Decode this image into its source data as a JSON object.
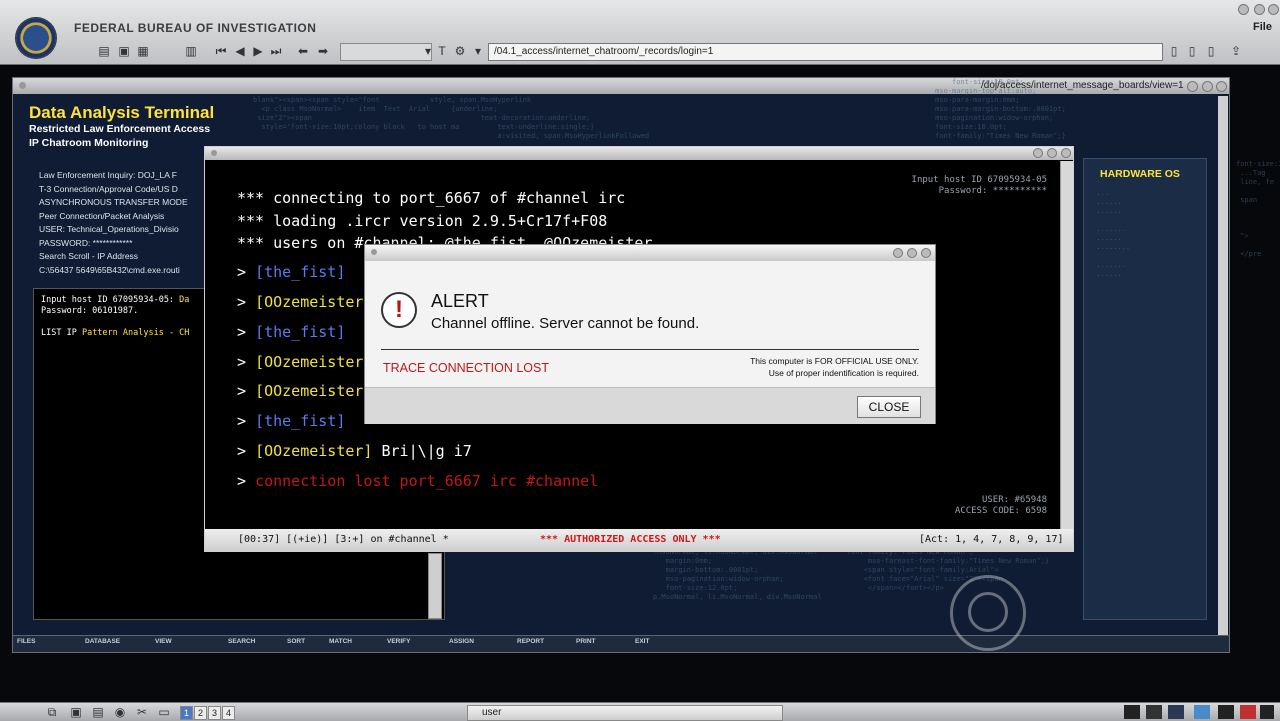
{
  "header": {
    "agency": "FEDERAL BUREAU OF INVESTIGATION",
    "file_menu": "File",
    "url": "/04.1_access/internet_chatroom/_records/login=1"
  },
  "main_window": {
    "url": "/doj/access/internet_message_boards/view=1",
    "title": "Data Analysis Terminal",
    "subtitle1": "Restricted Law Enforcement Access",
    "subtitle2": "IP Chatroom Monitoring",
    "info_lines": [
      "Law Enforcement Inquiry: DOJ_LA F",
      "T-3 Connection/Approval Code/US D",
      "ASYNCHRONOUS TRANSFER MODE",
      "Peer Connection/Packet Analysis",
      "USER: Technical_Operations_Divisio",
      "PASSWORD: ************",
      "Search Scroll - IP Address",
      "C:\\56437 5649\\65B432\\cmd.exe.routi"
    ],
    "left_terminal": {
      "line1_label": "Input host ID 67095934-05:",
      "line1_value": " Da",
      "line2": "Password: 06101987.",
      "line3_label": "LIST IP ",
      "line3_value": "Pattern Analysis - CH"
    },
    "hardware_label": "HARDWARE OS",
    "bottom_buttons": [
      "FILES",
      "DATABASE",
      "VIEW",
      "SEARCH",
      "SORT",
      "MATCH",
      "VERIFY",
      "ASSIGN",
      "REPORT",
      "PRINT",
      "EXIT"
    ]
  },
  "irc": {
    "host_info": "Input host ID 67095934-05",
    "password": "Password: **********",
    "lines": [
      "*** connecting to port_6667 of #channel irc",
      "*** loading .ircr version 2.9.5+Cr17f+F08",
      "*** users on #channel: @the_fist, @OOzemeister"
    ],
    "messages": [
      {
        "prompt": ">",
        "nick": "[the_fist]",
        "text": ""
      },
      {
        "prompt": ">",
        "nick": "[OOzemeister]",
        "text": ""
      },
      {
        "prompt": ">",
        "nick": "[the_fist]",
        "text": ""
      },
      {
        "prompt": ">",
        "nick": "[OOzemeister]",
        "text": ""
      },
      {
        "prompt": ">",
        "nick": "[OOzemeister]",
        "text": ""
      },
      {
        "prompt": ">",
        "nick": "[the_fist]",
        "text": ""
      },
      {
        "prompt": ">",
        "nick": "[OOzemeister]",
        "text": " Bri|\\|g i7"
      },
      {
        "prompt": ">",
        "nick": "",
        "text": "connection lost port_6667 irc #channel"
      }
    ],
    "user": "USER: #65948",
    "access_code": "ACCESS CODE: 6598",
    "status_left": "[00:37] [(+ie)] [3:+] on #channel *",
    "status_center": "*** AUTHORIZED ACCESS ONLY ***",
    "status_right": "[Act: 1, 4, 7, 8, 9, 17]"
  },
  "alert": {
    "heading": "ALERT",
    "message": "Channel offline. Server cannot be found.",
    "trace": "TRACE CONNECTION LOST",
    "note1": "This computer is FOR OFFICIAL USE ONLY.",
    "note2": "Use of proper indentification is required.",
    "close_label": "CLOSE"
  },
  "taskbar": {
    "workspaces": [
      "1",
      "2",
      "3",
      "4"
    ],
    "task_label": "user"
  },
  "colors": {
    "accent_yellow": "#ffe23a",
    "nick_blue": "#5a7bf0",
    "nick_yellow": "#f2e23a",
    "error_red": "#c01818"
  }
}
